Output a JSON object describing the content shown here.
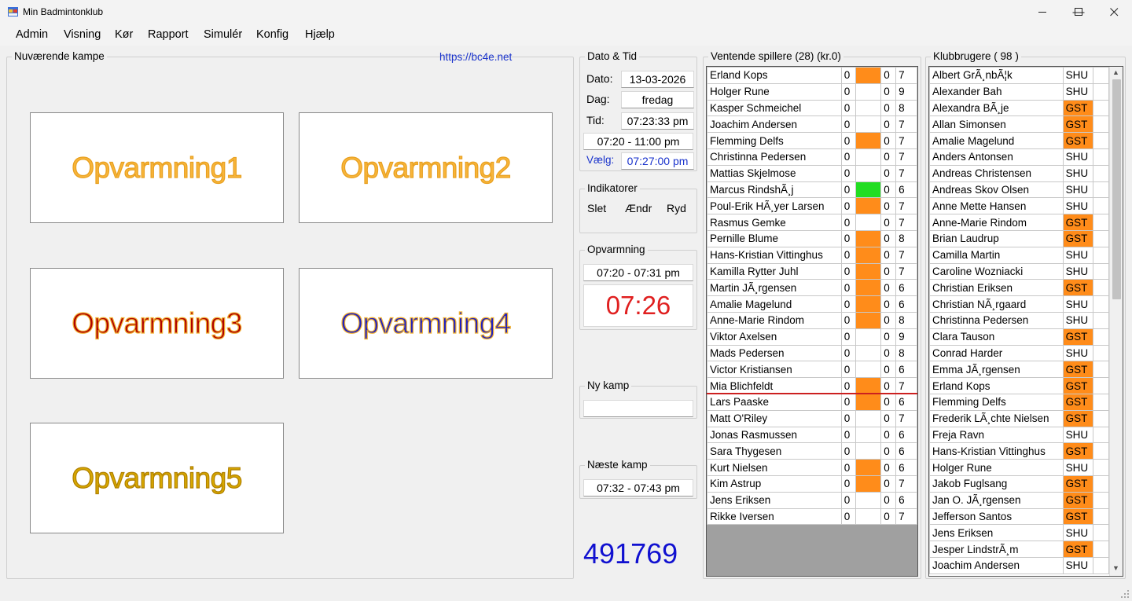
{
  "window": {
    "title": "Min Badmintonklub",
    "minimize": "—",
    "maximize": "☐",
    "close": "✕"
  },
  "menu": [
    "Admin",
    "Visning",
    "Kør",
    "Rapport",
    "Simulér",
    "Konfig",
    "Hjælp"
  ],
  "current_matches": {
    "title": "Nuværende kampe",
    "link": "https://bc4e.net",
    "courts": [
      {
        "label": "Opvarmning1",
        "fill": "#f8b53a",
        "stroke": "#e8a020"
      },
      {
        "label": "Opvarmning2",
        "fill": "#f8b53a",
        "stroke": "#e8a020"
      },
      {
        "label": "Opvarmning3",
        "fill": "#b00000",
        "stroke": "#f0b030"
      },
      {
        "label": "Opvarmning4",
        "fill": "#2020c0",
        "stroke": "#f0b030"
      },
      {
        "label": "Opvarmning5",
        "fill": "#d8a800",
        "stroke": "#b08000"
      }
    ]
  },
  "datetime": {
    "title": "Dato & Tid",
    "date_label": "Dato:",
    "date": "13-03-2026",
    "day_label": "Dag:",
    "day": "fredag",
    "time_label": "Tid:",
    "time": "07:23:33 pm",
    "range": "07:20 - 11:00 pm",
    "select_label": "Vælg:",
    "select": "07:27:00 pm"
  },
  "indicators": {
    "title": "Indikatorer",
    "delete": "Slet",
    "change": "Ændr",
    "clear": "Ryd"
  },
  "warmup": {
    "title": "Opvarmning",
    "range": "07:20 - 07:31 pm",
    "clock": "07:26"
  },
  "new_match": {
    "title": "Ny kamp",
    "value": ""
  },
  "next_match": {
    "title": "Næste kamp",
    "range": "07:32 - 07:43 pm"
  },
  "counter": "491769",
  "waiting": {
    "title": "Ventende spillere (28) (kr.0)",
    "colors": {
      "orange": "#ff8c1a",
      "green": "#22dd22"
    },
    "rows": [
      {
        "name": "Erland Kops",
        "a": "0",
        "ind": "orange",
        "b": "0",
        "c": "7"
      },
      {
        "name": "Holger Rune",
        "a": "0",
        "ind": "",
        "b": "0",
        "c": "9"
      },
      {
        "name": "Kasper Schmeichel",
        "a": "0",
        "ind": "",
        "b": "0",
        "c": "8"
      },
      {
        "name": "Joachim Andersen",
        "a": "0",
        "ind": "",
        "b": "0",
        "c": "7"
      },
      {
        "name": "Flemming Delfs",
        "a": "0",
        "ind": "orange",
        "b": "0",
        "c": "7"
      },
      {
        "name": "Christinna Pedersen",
        "a": "0",
        "ind": "",
        "b": "0",
        "c": "7"
      },
      {
        "name": "Mattias Skjelmose",
        "a": "0",
        "ind": "",
        "b": "0",
        "c": "7"
      },
      {
        "name": "Marcus RindshÃ¸j",
        "a": "0",
        "ind": "green",
        "b": "0",
        "c": "6"
      },
      {
        "name": "Poul-Erik HÃ¸yer Larsen",
        "a": "0",
        "ind": "orange",
        "b": "0",
        "c": "7"
      },
      {
        "name": "Rasmus Gemke",
        "a": "0",
        "ind": "",
        "b": "0",
        "c": "7"
      },
      {
        "name": "Pernille Blume",
        "a": "0",
        "ind": "orange",
        "b": "0",
        "c": "8"
      },
      {
        "name": "Hans-Kristian Vittinghus",
        "a": "0",
        "ind": "orange",
        "b": "0",
        "c": "7"
      },
      {
        "name": "Kamilla Rytter Juhl",
        "a": "0",
        "ind": "orange",
        "b": "0",
        "c": "7"
      },
      {
        "name": "Martin JÃ¸rgensen",
        "a": "0",
        "ind": "orange",
        "b": "0",
        "c": "6"
      },
      {
        "name": "Amalie Magelund",
        "a": "0",
        "ind": "orange",
        "b": "0",
        "c": "6"
      },
      {
        "name": "Anne-Marie Rindom",
        "a": "0",
        "ind": "orange",
        "b": "0",
        "c": "8"
      },
      {
        "name": "Viktor Axelsen",
        "a": "0",
        "ind": "",
        "b": "0",
        "c": "9"
      },
      {
        "name": "Mads Pedersen",
        "a": "0",
        "ind": "",
        "b": "0",
        "c": "8"
      },
      {
        "name": "Victor Kristiansen",
        "a": "0",
        "ind": "",
        "b": "0",
        "c": "6"
      },
      {
        "name": "Mia Blichfeldt",
        "a": "0",
        "ind": "orange",
        "b": "0",
        "c": "7"
      },
      {
        "name": "Lars Paaske",
        "a": "0",
        "ind": "orange",
        "b": "0",
        "c": "6"
      },
      {
        "name": "Matt O'Riley",
        "a": "0",
        "ind": "",
        "b": "0",
        "c": "7"
      },
      {
        "name": "Jonas Rasmussen",
        "a": "0",
        "ind": "",
        "b": "0",
        "c": "6"
      },
      {
        "name": "Sara Thygesen",
        "a": "0",
        "ind": "",
        "b": "0",
        "c": "6"
      },
      {
        "name": "Kurt Nielsen",
        "a": "0",
        "ind": "orange",
        "b": "0",
        "c": "6"
      },
      {
        "name": "Kim Astrup",
        "a": "0",
        "ind": "orange",
        "b": "0",
        "c": "7"
      },
      {
        "name": "Jens Eriksen",
        "a": "0",
        "ind": "",
        "b": "0",
        "c": "6"
      },
      {
        "name": "Rikke Iversen",
        "a": "0",
        "ind": "",
        "b": "0",
        "c": "7"
      }
    ]
  },
  "members": {
    "title": "Klubbrugere ( 98 )",
    "rows": [
      {
        "name": "Albert GrÃ¸nbÃ¦k",
        "type": "SHU"
      },
      {
        "name": "Alexander Bah",
        "type": "SHU"
      },
      {
        "name": "Alexandra BÃ¸je",
        "type": "GST"
      },
      {
        "name": "Allan Simonsen",
        "type": "GST"
      },
      {
        "name": "Amalie Magelund",
        "type": "GST"
      },
      {
        "name": "Anders Antonsen",
        "type": "SHU"
      },
      {
        "name": "Andreas Christensen",
        "type": "SHU"
      },
      {
        "name": "Andreas Skov Olsen",
        "type": "SHU"
      },
      {
        "name": "Anne Mette Hansen",
        "type": "SHU"
      },
      {
        "name": "Anne-Marie Rindom",
        "type": "GST"
      },
      {
        "name": "Brian Laudrup",
        "type": "GST"
      },
      {
        "name": "Camilla Martin",
        "type": "SHU"
      },
      {
        "name": "Caroline Wozniacki",
        "type": "SHU"
      },
      {
        "name": "Christian Eriksen",
        "type": "GST"
      },
      {
        "name": "Christian NÃ¸rgaard",
        "type": "SHU"
      },
      {
        "name": "Christinna Pedersen",
        "type": "SHU"
      },
      {
        "name": "Clara Tauson",
        "type": "GST"
      },
      {
        "name": "Conrad Harder",
        "type": "SHU"
      },
      {
        "name": "Emma JÃ¸rgensen",
        "type": "GST"
      },
      {
        "name": "Erland Kops",
        "type": "GST"
      },
      {
        "name": "Flemming Delfs",
        "type": "GST"
      },
      {
        "name": "Frederik LÃ¸chte Nielsen",
        "type": "GST"
      },
      {
        "name": "Freja Ravn",
        "type": "SHU"
      },
      {
        "name": "Hans-Kristian Vittinghus",
        "type": "GST"
      },
      {
        "name": "Holger Rune",
        "type": "SHU"
      },
      {
        "name": "Jakob Fuglsang",
        "type": "GST"
      },
      {
        "name": "Jan O. JÃ¸rgensen",
        "type": "GST"
      },
      {
        "name": "Jefferson Santos",
        "type": "GST"
      },
      {
        "name": "Jens Eriksen",
        "type": "SHU"
      },
      {
        "name": "Jesper LindstrÃ¸m",
        "type": "GST"
      },
      {
        "name": "Joachim Andersen",
        "type": "SHU"
      }
    ]
  }
}
